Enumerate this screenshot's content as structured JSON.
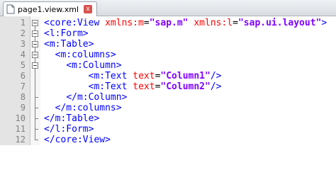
{
  "tab": {
    "filename": "page1.view.xml",
    "close_glyph": "x"
  },
  "editor": {
    "lines": [
      {
        "num": "1",
        "indent": "",
        "segments": [
          {
            "t": "tag",
            "v": "<core:View "
          },
          {
            "t": "attr",
            "v": "xmlns:m"
          },
          {
            "t": "eq",
            "v": "="
          },
          {
            "t": "str",
            "v": "\"sap.m\""
          },
          {
            "t": "tag",
            "v": " "
          },
          {
            "t": "attr",
            "v": "xmlns:l"
          },
          {
            "t": "eq",
            "v": "="
          },
          {
            "t": "str",
            "v": "\"sap.ui.layout\""
          },
          {
            "t": "tag",
            "v": ">"
          }
        ]
      },
      {
        "num": "2",
        "indent": "",
        "segments": [
          {
            "t": "tag",
            "v": "<l:Form>"
          }
        ]
      },
      {
        "num": "3",
        "indent": "",
        "segments": [
          {
            "t": "tag",
            "v": "<m:Table>"
          }
        ]
      },
      {
        "num": "4",
        "indent": "  ",
        "segments": [
          {
            "t": "tag",
            "v": "<m:columns>"
          }
        ]
      },
      {
        "num": "5",
        "indent": "    ",
        "segments": [
          {
            "t": "tag",
            "v": "<m:Column>"
          }
        ]
      },
      {
        "num": "6",
        "indent": "        ",
        "segments": [
          {
            "t": "tag",
            "v": "<m:Text "
          },
          {
            "t": "attr",
            "v": "text"
          },
          {
            "t": "eq",
            "v": "="
          },
          {
            "t": "str",
            "v": "\"Column1\""
          },
          {
            "t": "tag",
            "v": "/>"
          }
        ]
      },
      {
        "num": "7",
        "indent": "        ",
        "segments": [
          {
            "t": "tag",
            "v": "<m:Text "
          },
          {
            "t": "attr",
            "v": "text"
          },
          {
            "t": "eq",
            "v": "="
          },
          {
            "t": "str",
            "v": "\"Column2\""
          },
          {
            "t": "tag",
            "v": "/>"
          }
        ]
      },
      {
        "num": "8",
        "indent": "    ",
        "segments": [
          {
            "t": "tag",
            "v": "</m:Column>"
          }
        ]
      },
      {
        "num": "9",
        "indent": "  ",
        "segments": [
          {
            "t": "tag",
            "v": "</m:columns>"
          }
        ]
      },
      {
        "num": "10",
        "indent": "",
        "segments": [
          {
            "t": "tag",
            "v": "</m:Table>"
          }
        ]
      },
      {
        "num": "11",
        "indent": "",
        "segments": [
          {
            "t": "tag",
            "v": "</l:Form>"
          }
        ]
      },
      {
        "num": "12",
        "indent": "",
        "segments": [
          {
            "t": "tag",
            "v": "</core:View>"
          }
        ]
      }
    ]
  },
  "colors": {
    "tag": "#0000ff",
    "attr": "#ff0000",
    "string": "#8000ff",
    "line_number": "#808080"
  }
}
